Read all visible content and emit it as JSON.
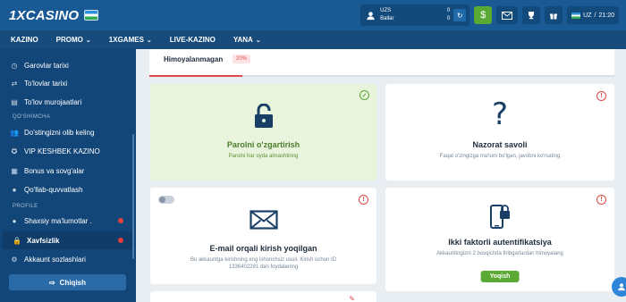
{
  "brand": {
    "logo": "1XCASINO"
  },
  "header": {
    "currency": "UZS",
    "balance": "0",
    "points_label": "Ballar",
    "points": "0",
    "deposit_icon": "dollar-icon",
    "language": "UZ",
    "time": "21:20"
  },
  "nav": {
    "items": [
      {
        "label": "KAZINO",
        "dropdown": false
      },
      {
        "label": "PROMO",
        "dropdown": true
      },
      {
        "label": "1XGAMES",
        "dropdown": true
      },
      {
        "label": "LIVE-KAZINO",
        "dropdown": false
      },
      {
        "label": "YANA",
        "dropdown": true
      }
    ]
  },
  "sidebar": {
    "items": [
      {
        "label": "Garovlar tarixi",
        "icon": "clock-icon"
      },
      {
        "label": "To'lovlar tarixi",
        "icon": "transfer-icon"
      },
      {
        "label": "To'lov murojaatlari",
        "icon": "receipt-icon"
      }
    ],
    "section_extra": "QO'SHIMCHA",
    "extra_items": [
      {
        "label": "Do'stingizni olib keling",
        "icon": "users-icon"
      },
      {
        "label": "VIP KESHBEK KAZINO",
        "icon": "vip-icon"
      },
      {
        "label": "Bonus va sovg'alar",
        "icon": "gift-icon"
      },
      {
        "label": "Qo'llab-quvvatlash",
        "icon": "support-icon"
      }
    ],
    "section_profile": "PROFILE",
    "profile_items": [
      {
        "label": "Shaxsiy ma'lumotlar .",
        "icon": "user-icon",
        "warning": true
      },
      {
        "label": "Xavfsizlik",
        "icon": "lock-icon",
        "warning": true,
        "active": true
      },
      {
        "label": "Akkaunt sozlashlari",
        "icon": "gear-icon"
      }
    ],
    "logout_label": "Chiqish"
  },
  "security": {
    "status_label": "Himoyalanmagan",
    "percent_text": "20%",
    "percent": 20,
    "cards": [
      {
        "title": "Parolni o'zgartirish",
        "desc": "Parolni har oyda almashtiring",
        "status": "ok"
      },
      {
        "title": "Nazorat savoli",
        "desc": "Faqat o'zingizga ma'lum bo'lgan, javobni ko'rsating",
        "status": "warn"
      },
      {
        "title": "E-mail orqali kirish yoqilgan",
        "desc": "Bu akkauntga kirishning eng ishonchsiz usuli. Kirish uchun ID 1336402281 dan foydalaning",
        "status": "warn"
      },
      {
        "title": "Ikki faktorli autentifikatsiya",
        "desc": "Akkauntingizni 2 bosqichda firibgarlardan himoyalang",
        "status": "warn",
        "button": "Yoqish"
      }
    ]
  },
  "colors": {
    "header": "#1a5a94",
    "sidebar": "#134678",
    "accent_green": "#5ba935",
    "danger": "#e04848"
  }
}
